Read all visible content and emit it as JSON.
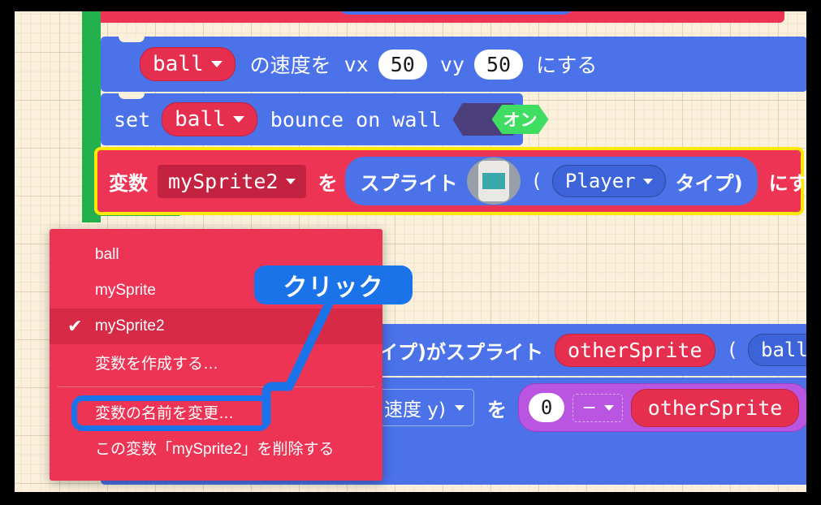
{
  "app": {
    "name": "MakeCode Arcade block editor",
    "locale": "ja"
  },
  "workspace": {
    "background_color": "#faf0dc",
    "rail_color": "#23b14d",
    "highlight_color": "#ffe800"
  },
  "blocks": {
    "velocity_row": {
      "sprite_label": "ball",
      "text_1": "の速度を",
      "vx_label": "vx",
      "vx_value": "50",
      "vy_label": "vy",
      "vy_value": "50",
      "text_2": "にする",
      "color": "#4b72e8"
    },
    "bounce_row": {
      "prefix": "set",
      "sprite_label": "ball",
      "text": "bounce on wall",
      "toggle_value": "オン",
      "toggle_color": "#3fdd62",
      "color": "#4b72e8"
    },
    "variable_row": {
      "prefix": "変数",
      "variable_label": "mySprite2",
      "particle": "を",
      "sprite_word": "スプライト",
      "image_icon": "sprite-image-icon",
      "paren_open": "(",
      "kind_label": "Player",
      "kind_word": "タイプ)",
      "suffix": "にする",
      "color": "#ee3455",
      "inner_color": "#4b72e8",
      "outline_color": "#ffe800"
    },
    "if_row": {
      "text_left": "ァイプ)がスプライト",
      "other_sprite_label": "otherSprite",
      "paren_open": "(",
      "kind_label": "ball",
      "color": "#4b72e8"
    },
    "set_row": {
      "field_label": "(速度 y)",
      "particle": "を",
      "number_value": "0",
      "operator": "−",
      "operand_label": "otherSprite",
      "operator_color": "#b955e0",
      "color": "#4b72e8"
    }
  },
  "dropdown_menu": {
    "background": "#ee3455",
    "selected_background": "#d62a47",
    "items": [
      {
        "label": "ball",
        "checked": false,
        "highlighted": false
      },
      {
        "label": "mySprite",
        "checked": false,
        "highlighted": false
      },
      {
        "label": "mySprite2",
        "checked": true,
        "highlighted": true
      },
      {
        "label": "変数を作成する…",
        "checked": false,
        "highlighted": false
      },
      {
        "label": "変数の名前を変更…",
        "checked": false,
        "highlighted": false
      },
      {
        "label": "この変数「mySprite2」を削除する",
        "checked": false,
        "highlighted": false
      }
    ],
    "check_glyph": "✔",
    "separator_after_index": 3
  },
  "annotation": {
    "callout_text": "クリック",
    "callout_color": "#1a73e8",
    "highlight_target": "変数の名前を変更…"
  }
}
